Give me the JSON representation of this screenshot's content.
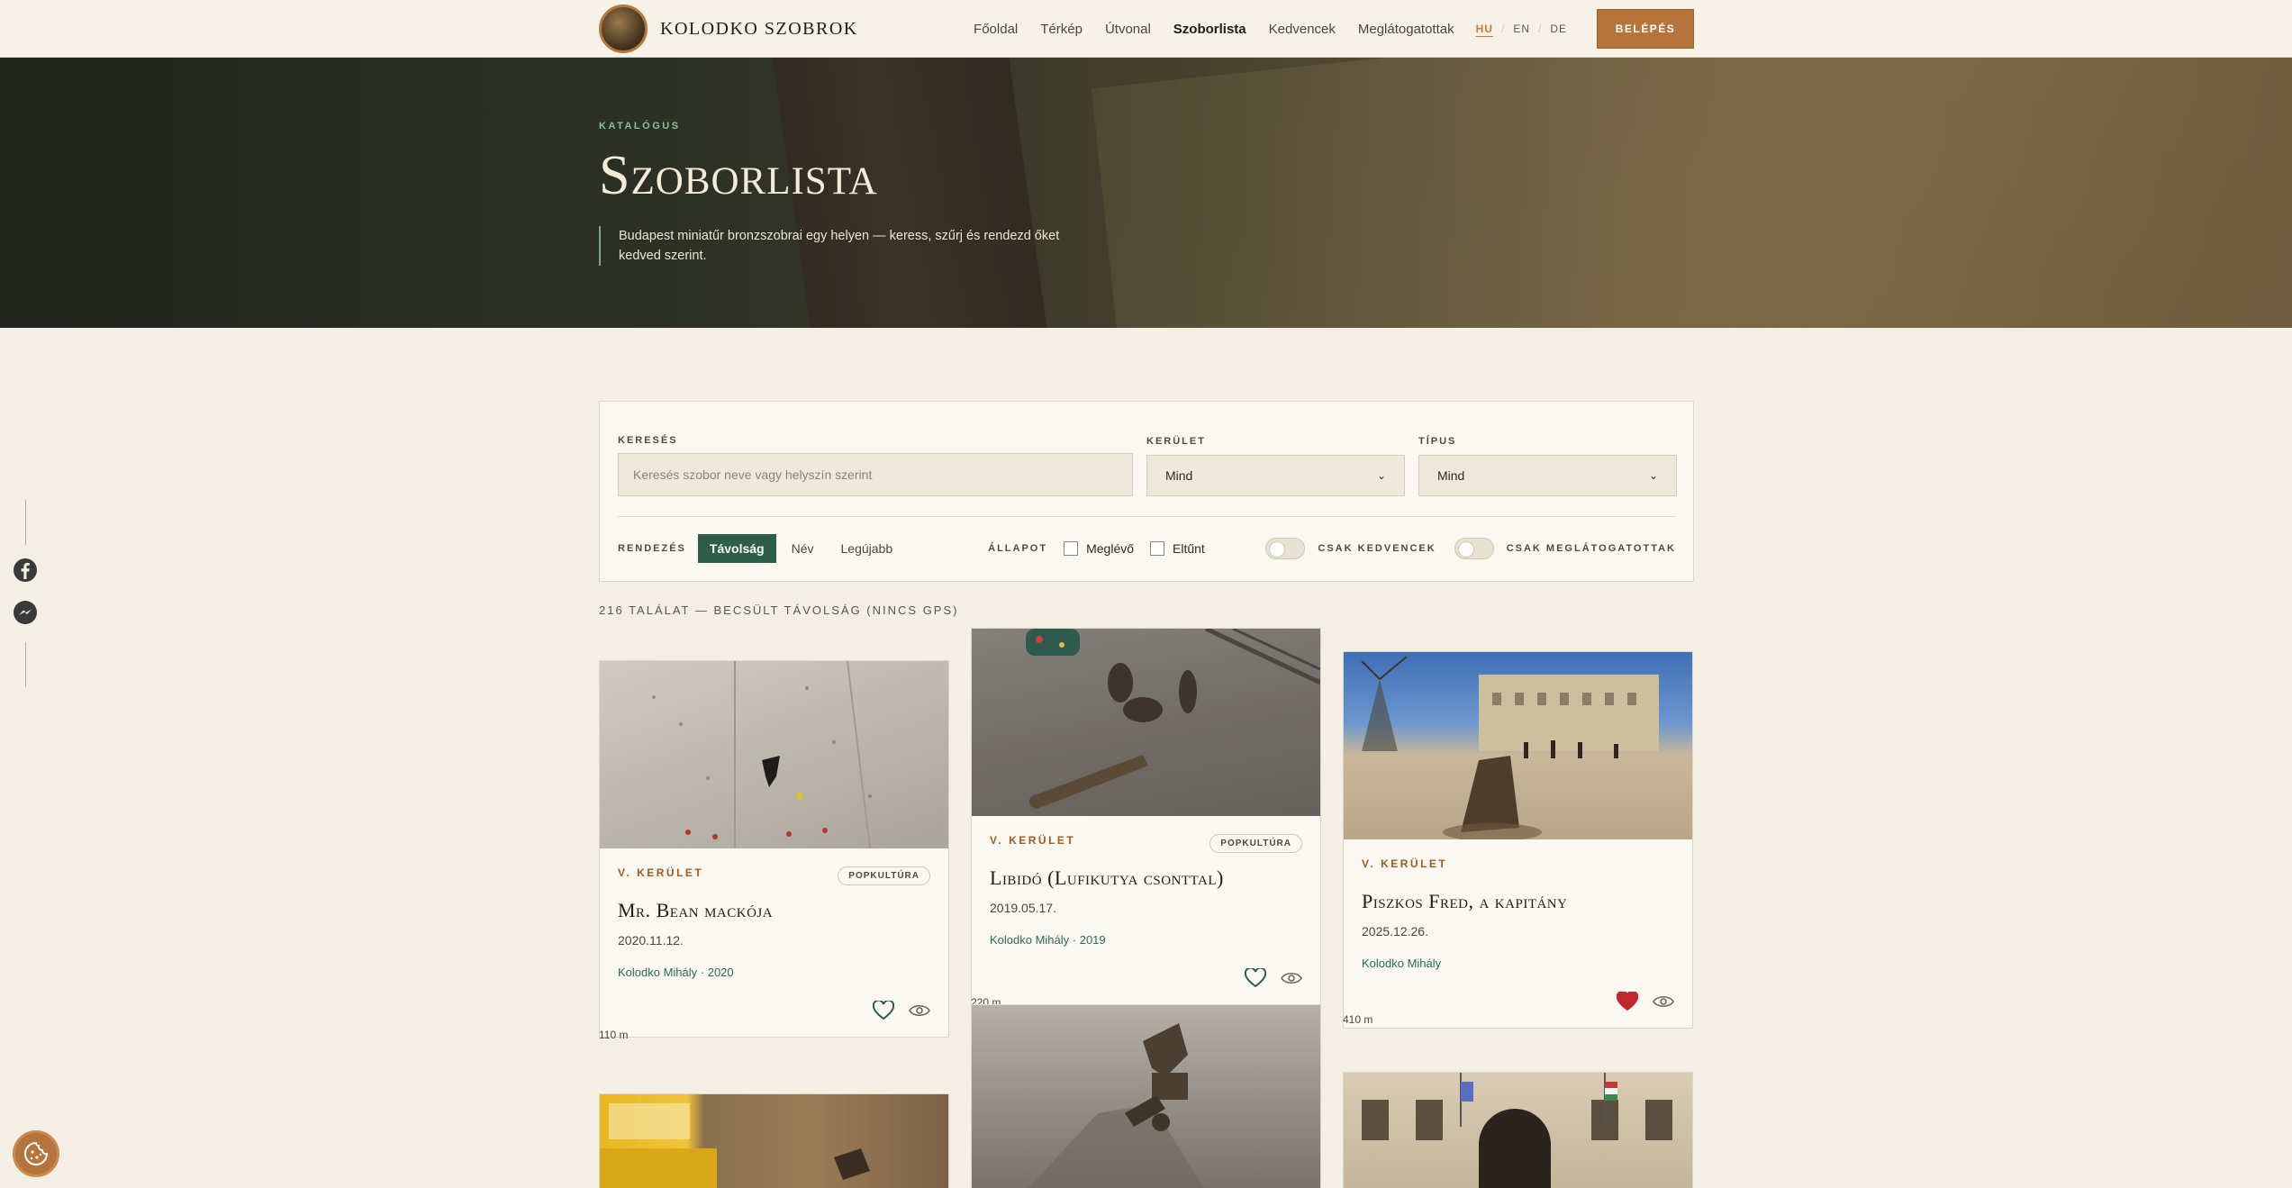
{
  "nav": {
    "brand": "KOLODKO SZOBROK",
    "links": [
      "Főoldal",
      "Térkép",
      "Útvonal",
      "Szoborlista",
      "Kedvencek",
      "Meglátogatottak"
    ],
    "active_link": "Szoborlista",
    "languages": [
      "HU",
      "EN",
      "DE"
    ],
    "active_language": "HU",
    "login": "BELÉPÉS"
  },
  "hero": {
    "eyebrow": "KATALÓGUS",
    "title": "Szoborlista",
    "subtitle": "Budapest miniatűr bronzszobrai egy helyen — keress, szűrj és rendezd őket kedved szerint."
  },
  "filters": {
    "search_label": "KERESÉS",
    "search_placeholder": "Keresés szobor neve vagy helyszín szerint",
    "district_label": "KERÜLET",
    "district_value": "Mind",
    "type_label": "TÍPUS",
    "type_value": "Mind",
    "sort_label": "RENDEZÉS",
    "sort_options": [
      "Távolság",
      "Név",
      "Legújabb"
    ],
    "sort_selected": "Távolság",
    "state_label": "ÁLLAPOT",
    "state_options": [
      "Meglévő",
      "Eltűnt"
    ],
    "toggle_favorites": "CSAK KEDVENCEK",
    "toggle_visited": "CSAK MEGLÁTOGATOTTAK"
  },
  "results_text": "216 TALÁLAT — BECSÜLT TÁVOLSÁG (NINCS GPS)",
  "cards": [
    {
      "district": "V. KERÜLET",
      "category": "POPKULTÚRA",
      "title": "Mr. Bean mackója",
      "date": "2020.11.12.",
      "author": "Kolodko Mihály · 2020",
      "distance": "110 m",
      "favorite": false
    },
    {
      "district": "V. KERÜLET",
      "category": "POPKULTÚRA",
      "title": "Libidó (Lufikutya csonttal)",
      "date": "2019.05.17.",
      "author": "Kolodko Mihály · 2019",
      "distance": "220 m",
      "favorite": false
    },
    {
      "district": "V. KERÜLET",
      "category": "",
      "title": "Piszkos Fred, a kapitány",
      "date": "2025.12.26.",
      "author": "Kolodko Mihály",
      "distance": "410 m",
      "favorite": true
    }
  ],
  "colors": {
    "accent": "#b4743b",
    "green": "#2f5e48",
    "heart_red": "#c0282d"
  }
}
